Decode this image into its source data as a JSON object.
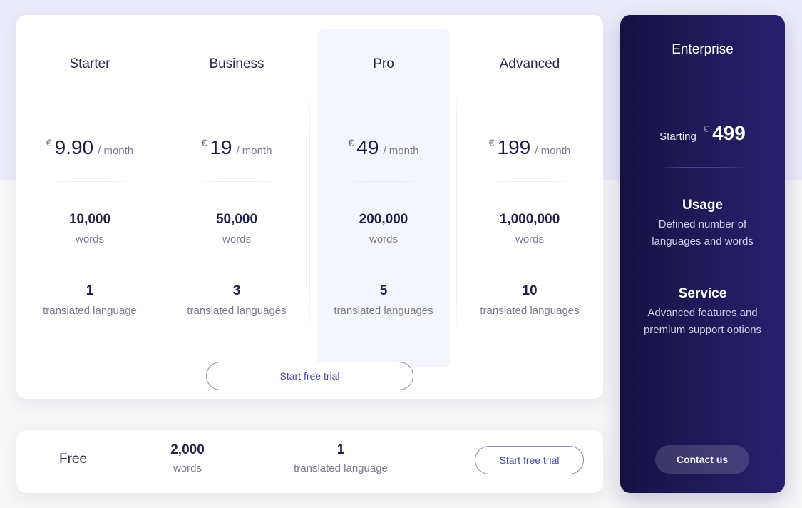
{
  "plans": [
    {
      "name": "Starter",
      "currency": "€",
      "price": "9.90",
      "period": "/ month",
      "words": "10,000",
      "words_label": "words",
      "languages": "1",
      "languages_label": "translated language",
      "highlighted": false
    },
    {
      "name": "Business",
      "currency": "€",
      "price": "19",
      "period": "/ month",
      "words": "50,000",
      "words_label": "words",
      "languages": "3",
      "languages_label": "translated languages",
      "highlighted": false
    },
    {
      "name": "Pro",
      "currency": "€",
      "price": "49",
      "period": "/ month",
      "words": "200,000",
      "words_label": "words",
      "languages": "5",
      "languages_label": "translated languages",
      "highlighted": true
    },
    {
      "name": "Advanced",
      "currency": "€",
      "price": "199",
      "period": "/ month",
      "words": "1,000,000",
      "words_label": "words",
      "languages": "10",
      "languages_label": "translated languages",
      "highlighted": false
    }
  ],
  "main_cta": "Start free trial",
  "free_plan": {
    "name": "Free",
    "words": "2,000",
    "words_label": "words",
    "languages": "1",
    "languages_label": "translated language",
    "cta": "Start free trial"
  },
  "enterprise": {
    "title": "Enterprise",
    "starting_label": "Starting",
    "currency": "€",
    "price": "499",
    "usage_title": "Usage",
    "usage_desc": "Defined number of languages and words",
    "service_title": "Service",
    "service_desc": "Advanced features and premium support options",
    "cta": "Contact us"
  },
  "colors": {
    "accent": "#4b45a8",
    "enterprise_bg_start": "#151240",
    "enterprise_bg_end": "#2a1f70",
    "highlight_bg": "#f5f5fd"
  }
}
